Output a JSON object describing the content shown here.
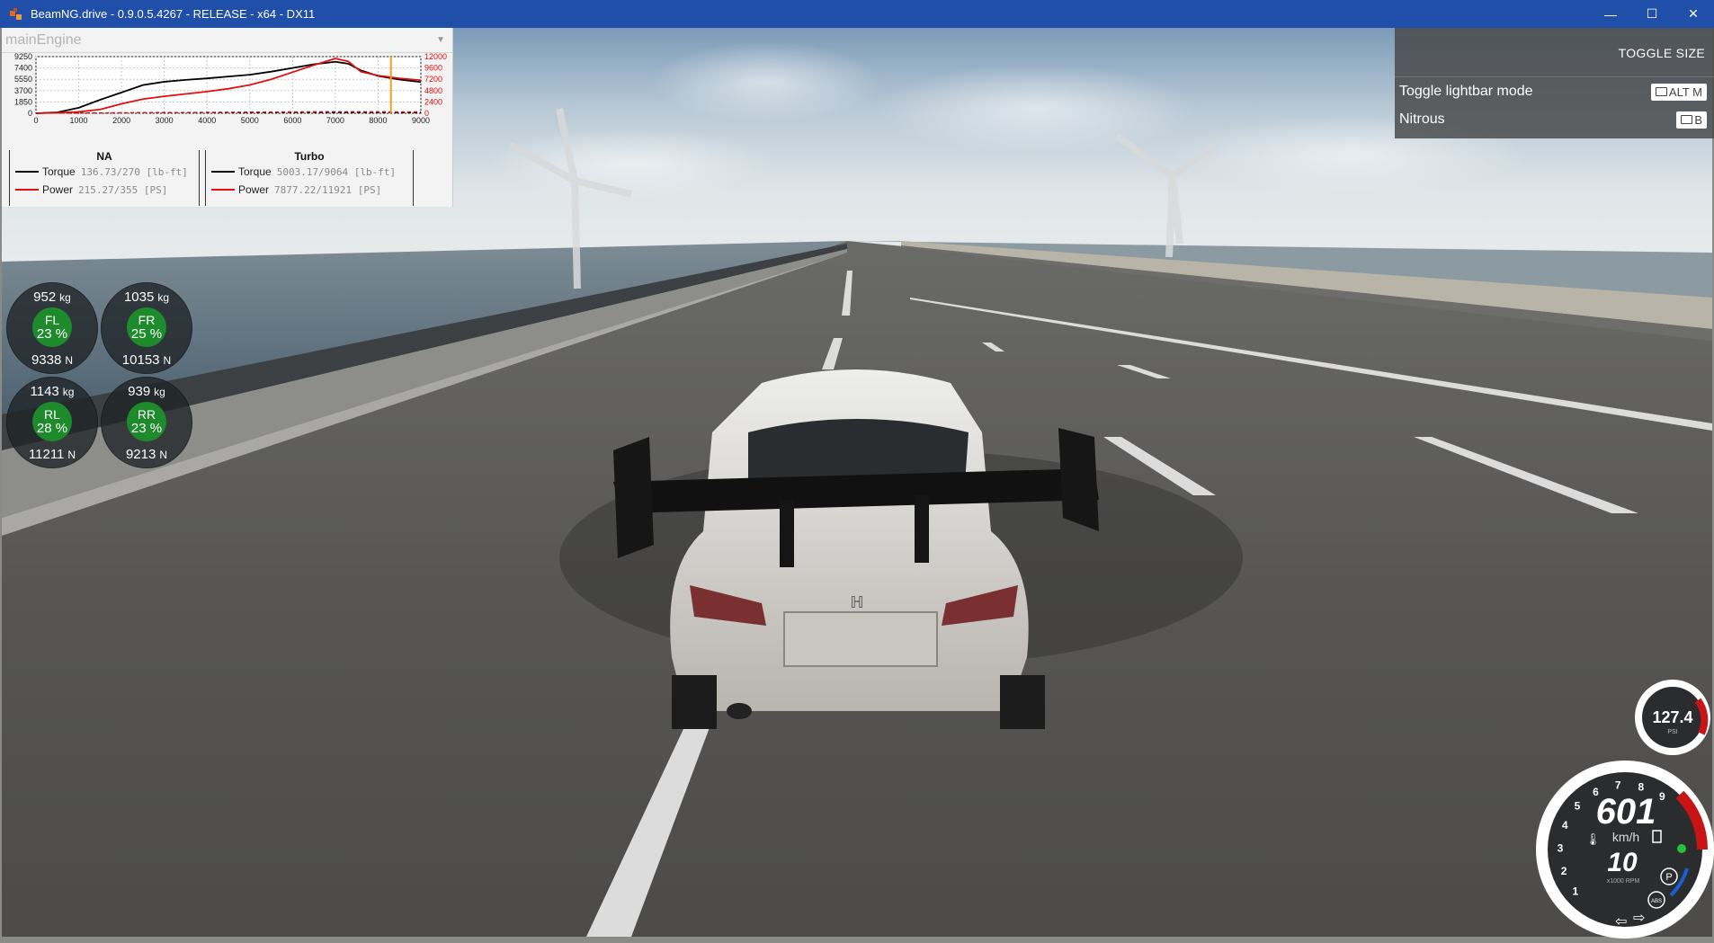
{
  "window": {
    "title": "BeamNG.drive - 0.9.0.5.4267 - RELEASE - x64 - DX11",
    "minimize": "—",
    "maximize": "☐",
    "close": "✕"
  },
  "engine_panel": {
    "selector_value": "mainEngine",
    "left_axis_ticks": [
      "9250",
      "7400",
      "5550",
      "3700",
      "1850",
      "0"
    ],
    "right_axis_ticks": [
      "12000",
      "9600",
      "7200",
      "4800",
      "2400",
      "0"
    ],
    "x_ticks": [
      "0",
      "1000",
      "2000",
      "3000",
      "4000",
      "5000",
      "6000",
      "7000",
      "8000",
      "9000"
    ],
    "legend_na": {
      "title": "NA",
      "torque_label": "Torque",
      "torque_value": "136.73/270 [lb-ft]",
      "power_label": "Power",
      "power_value": "215.27/355 [PS]"
    },
    "legend_turbo": {
      "title": "Turbo",
      "torque_label": "Torque",
      "torque_value": "5003.17/9064 [lb-ft]",
      "power_label": "Power",
      "power_value": "7877.22/11921 [PS]"
    }
  },
  "chart_data": {
    "type": "line",
    "x": [
      0,
      500,
      1000,
      1500,
      2000,
      2500,
      3000,
      3500,
      4000,
      4500,
      5000,
      5500,
      6000,
      6500,
      7000,
      7300,
      7600,
      8000,
      8500,
      9000
    ],
    "xlim": [
      0,
      9000
    ],
    "series": [
      {
        "name": "Torque",
        "axis": "left",
        "color": "#000000",
        "values": [
          0,
          150,
          900,
          2200,
          3400,
          4600,
          5150,
          5450,
          5700,
          6000,
          6300,
          6800,
          7400,
          8000,
          8400,
          8100,
          7000,
          6100,
          5500,
          5100
        ]
      },
      {
        "name": "Power",
        "axis": "right",
        "color": "#e01010",
        "values": [
          0,
          100,
          300,
          800,
          2000,
          3000,
          3600,
          4100,
          4600,
          5200,
          6000,
          7200,
          8700,
          10200,
          11600,
          11000,
          8800,
          8000,
          7400,
          7000
        ]
      },
      {
        "name": "Torque NA",
        "axis": "left",
        "color": "#000000",
        "dashed": true,
        "values": [
          0,
          20,
          40,
          60,
          80,
          100,
          110,
          120,
          125,
          130,
          132,
          134,
          136,
          135,
          130,
          128,
          125,
          120,
          115,
          110
        ]
      },
      {
        "name": "Power NA",
        "axis": "right",
        "color": "#e01010",
        "dashed": true,
        "values": [
          0,
          20,
          40,
          60,
          90,
          120,
          150,
          180,
          210,
          240,
          260,
          290,
          310,
          330,
          350,
          345,
          340,
          330,
          320,
          310
        ]
      }
    ],
    "ylim_left": [
      0,
      9250
    ],
    "ylim_right": [
      0,
      12000
    ],
    "current_rpm": 8300,
    "grid": true
  },
  "settings_panel": {
    "toggle_size_label": "TOGGLE SIZE",
    "rows": [
      {
        "label": "Toggle lightbar mode",
        "key": "ALT M"
      },
      {
        "label": "Nitrous",
        "key": "B"
      }
    ]
  },
  "wheels": [
    {
      "pos": "FL",
      "mass": "952",
      "mass_unit": "kg",
      "pct": "23 %",
      "force": "9338",
      "force_unit": "N"
    },
    {
      "pos": "FR",
      "mass": "1035",
      "mass_unit": "kg",
      "pct": "25 %",
      "force": "10153",
      "force_unit": "N"
    },
    {
      "pos": "RL",
      "mass": "1143",
      "mass_unit": "kg",
      "pct": "28 %",
      "force": "11211",
      "force_unit": "N"
    },
    {
      "pos": "RR",
      "mass": "939",
      "mass_unit": "kg",
      "pct": "23 %",
      "force": "9213",
      "force_unit": "N"
    }
  ],
  "boost_gauge": {
    "value": "127.4",
    "unit": "PSI",
    "ticks": [
      "10",
      "20",
      "30",
      "40",
      "50",
      "60",
      "70",
      "75",
      "80"
    ],
    "level": 0.85
  },
  "speedometer": {
    "speed": "601",
    "speed_unit": "km/h",
    "gear": "10",
    "rpm_unit": "x1000 RPM",
    "ticks": [
      "1",
      "2",
      "3",
      "4",
      "5",
      "6",
      "7",
      "8",
      "9"
    ],
    "rpm_level": 8.3,
    "indicator_p": "P",
    "indicator_abs": "ABS"
  },
  "colors": {
    "titlebar": "#1f4fa8",
    "wheel_ok": "#1d8a2c",
    "redline": "#c81414"
  }
}
